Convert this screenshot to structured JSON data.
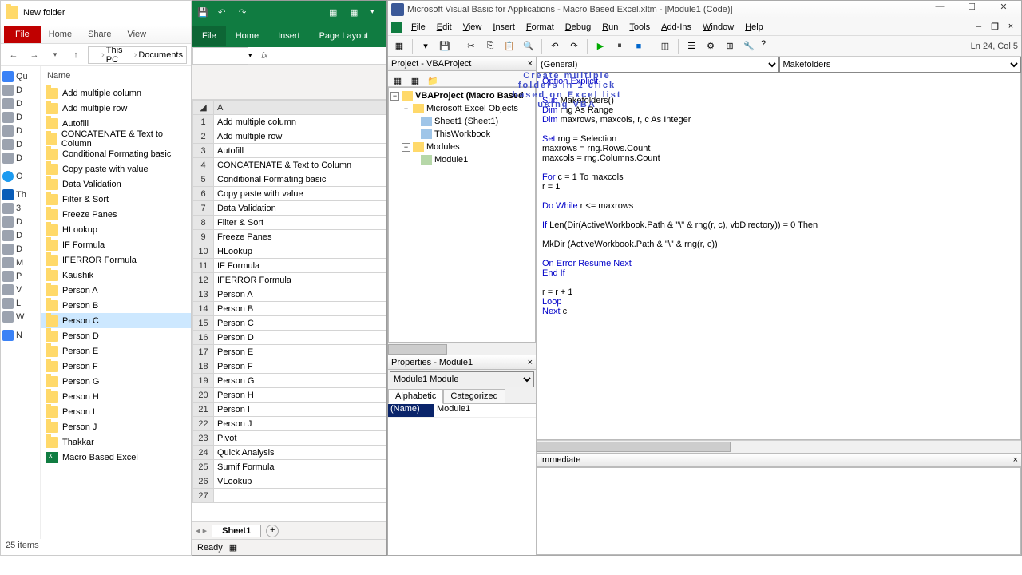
{
  "explorer": {
    "title": "New folder",
    "ribbon_file": "File",
    "ribbon_tabs": [
      "Home",
      "Share",
      "View"
    ],
    "breadcrumbs": [
      "This PC",
      "Documents"
    ],
    "col_name": "Name",
    "items": [
      "Add multiple column",
      "Add multiple row",
      "Autofill",
      "CONCATENATE & Text to Column",
      "Conditional Formating basic",
      "Copy paste with value",
      "Data Validation",
      "Filter & Sort",
      "Freeze Panes",
      "HLookup",
      "IF Formula",
      "IFERROR Formula",
      "Kaushik",
      "Person A",
      "Person B",
      "Person C",
      "Person D",
      "Person E",
      "Person F",
      "Person G",
      "Person H",
      "Person I",
      "Person J",
      "Thakkar"
    ],
    "file_item": "Macro Based Excel",
    "side_groups": [
      [
        "Qu",
        "D",
        "D",
        "D",
        "D",
        "D",
        "D"
      ],
      [
        "O"
      ],
      [
        "Th",
        "3",
        "D",
        "D",
        "D",
        "M",
        "P",
        "V",
        "L",
        "W"
      ],
      [
        "N"
      ]
    ],
    "status": "25 items"
  },
  "excel": {
    "ribbon_file": "File",
    "ribbon_tabs": [
      "Home",
      "Insert",
      "Page Layout"
    ],
    "name_box": "",
    "fx": "fx",
    "col": "A",
    "rows": [
      "Add multiple column",
      "Add multiple row",
      "Autofill",
      "CONCATENATE & Text to Column",
      "Conditional Formating basic",
      "Copy paste with value",
      "Data Validation",
      "Filter & Sort",
      "Freeze Panes",
      "HLookup",
      "IF Formula",
      "IFERROR Formula",
      "Person A",
      "Person B",
      "Person C",
      "Person D",
      "Person E",
      "Person F",
      "Person G",
      "Person H",
      "Person I",
      "Person J",
      "Pivot",
      "Quick Analysis",
      "Sumif Formula",
      "VLookup",
      ""
    ],
    "sheet_tab": "Sheet1",
    "status": "Ready"
  },
  "vbe": {
    "title": "Microsoft Visual Basic for Applications - Macro Based Excel.xltm - [Module1 (Code)]",
    "menu": [
      "File",
      "Edit",
      "View",
      "Insert",
      "Format",
      "Debug",
      "Run",
      "Tools",
      "Add-Ins",
      "Window",
      "Help"
    ],
    "tb_status": "Ln 24, Col 5",
    "project_title": "Project - VBAProject",
    "tree_root": "VBAProject (Macro Based",
    "tree_objects": "Microsoft Excel Objects",
    "tree_sheet": "Sheet1 (Sheet1)",
    "tree_wb": "ThisWorkbook",
    "tree_mods": "Modules",
    "tree_mod1": "Module1",
    "prop_title": "Properties - Module1",
    "prop_dd": "Module1 Module",
    "prop_tab1": "Alphabetic",
    "prop_tab2": "Categorized",
    "prop_name_label": "(Name)",
    "prop_name_value": "Module1",
    "dd_left": "(General)",
    "dd_right": "Makefolders",
    "imm_title": "Immediate",
    "code": [
      {
        "pre": "",
        "kw": "Option Explicit",
        "post": ""
      },
      {
        "pre": "",
        "kw": "",
        "post": ""
      },
      {
        "pre": "",
        "kw": "Sub",
        "post": " Makefolders()"
      },
      {
        "pre": "",
        "kw": "Dim",
        "post": " rng As Range"
      },
      {
        "pre": "",
        "kw": "Dim",
        "post": " maxrows, maxcols, r, c As Integer"
      },
      {
        "pre": "",
        "kw": "",
        "post": ""
      },
      {
        "pre": "",
        "kw": "Set",
        "post": " rng = Selection"
      },
      {
        "pre": "maxrows = rng.Rows.Count",
        "kw": "",
        "post": ""
      },
      {
        "pre": "maxcols = rng.Columns.Count",
        "kw": "",
        "post": ""
      },
      {
        "pre": "",
        "kw": "",
        "post": ""
      },
      {
        "pre": "",
        "kw": "For",
        "post": " c = 1 To maxcols"
      },
      {
        "pre": "r = 1",
        "kw": "",
        "post": ""
      },
      {
        "pre": "",
        "kw": "",
        "post": ""
      },
      {
        "pre": "",
        "kw": "Do While",
        "post": " r <= maxrows"
      },
      {
        "pre": "",
        "kw": "",
        "post": ""
      },
      {
        "pre": "",
        "kw": "If",
        "post": " Len(Dir(ActiveWorkbook.Path & \"\\\" & rng(r, c), vbDirectory)) = 0 Then"
      },
      {
        "pre": "",
        "kw": "",
        "post": ""
      },
      {
        "pre": "MkDir (ActiveWorkbook.Path & \"\\\" & rng(r, c))",
        "kw": "",
        "post": ""
      },
      {
        "pre": "",
        "kw": "",
        "post": ""
      },
      {
        "pre": "",
        "kw": "On Error Resume Next",
        "post": ""
      },
      {
        "pre": "",
        "kw": "End If",
        "post": ""
      },
      {
        "pre": "",
        "kw": "",
        "post": ""
      },
      {
        "pre": "r = r + 1",
        "kw": "",
        "post": ""
      },
      {
        "pre": "",
        "kw": "Loop",
        "post": ""
      },
      {
        "pre": "",
        "kw": "Next",
        "post": " c"
      }
    ]
  },
  "overlay": {
    "l1": "Create multiple",
    "l2": "folders in 1 click",
    "l3": "based on Excel list",
    "l4": "using VBA"
  }
}
